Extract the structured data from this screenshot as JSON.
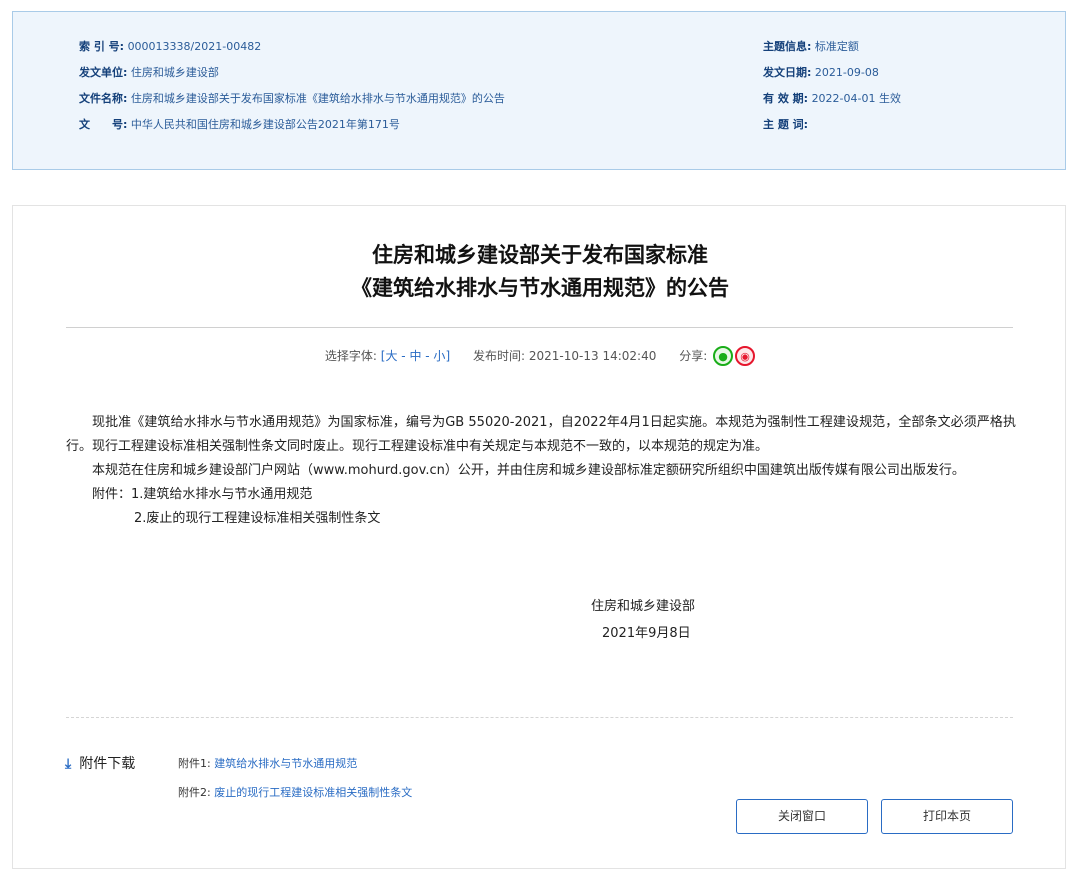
{
  "info": {
    "index_label": "索 引 号:",
    "index_value": "000013338/2021-00482",
    "issuer_label": "发文单位:",
    "issuer_value": "住房和城乡建设部",
    "filename_label": "文件名称:",
    "filename_value": "住房和城乡建设部关于发布国家标准《建筑给水排水与节水通用规范》的公告",
    "docno_label": "文　　号:",
    "docno_value": "中华人民共和国住房和城乡建设部公告2021年第171号",
    "topic_label": "主题信息:",
    "topic_value": "标准定额",
    "date_label": "发文日期:",
    "date_value": "2021-09-08",
    "validity_label": "有 效 期:",
    "validity_value": "2022-04-01 生效",
    "keywords_label": "主 题 词:",
    "keywords_value": ""
  },
  "article": {
    "title_line1": "住房和城乡建设部关于发布国家标准",
    "title_line2": "《建筑给水排水与节水通用规范》的公告",
    "font_label": "选择字体:",
    "font_bracket_open": "[",
    "font_large": "大",
    "font_sep1": " - ",
    "font_medium": "中",
    "font_sep2": " - ",
    "font_small": "小",
    "font_bracket_close": "]",
    "publish_label": "发布时间:",
    "publish_time": "2021-10-13 14:02:40",
    "share_label": "分享:",
    "wechat_glyph": "●",
    "weibo_glyph": "◉",
    "para1": "现批准《建筑给水排水与节水通用规范》为国家标准，编号为GB 55020-2021，自2022年4月1日起实施。本规范为强制性工程建设规范，全部条文必须严格执行。现行工程建设标准相关强制性条文同时废止。现行工程建设标准中有关规定与本规范不一致的，以本规范的规定为准。",
    "para2": "本规范在住房和城乡建设部门户网站（www.mohurd.gov.cn）公开，并由住房和城乡建设部标准定额研究所组织中国建筑出版传媒有限公司出版发行。",
    "attach_line1": "附件：1.建筑给水排水与节水通用规范",
    "attach_line2": "2.废止的现行工程建设标准相关强制性条文",
    "sign_org": "住房和城乡建设部",
    "sign_date": "2021年9月8日"
  },
  "downloads": {
    "heading": "附件下载",
    "icon": "⤓",
    "items": [
      {
        "prefix": "附件1:",
        "link": "建筑给水排水与节水通用规范"
      },
      {
        "prefix": "附件2:",
        "link": "废止的现行工程建设标准相关强制性条文"
      }
    ]
  },
  "buttons": {
    "close_label": "关闭窗口",
    "print_label": "打印本页"
  }
}
